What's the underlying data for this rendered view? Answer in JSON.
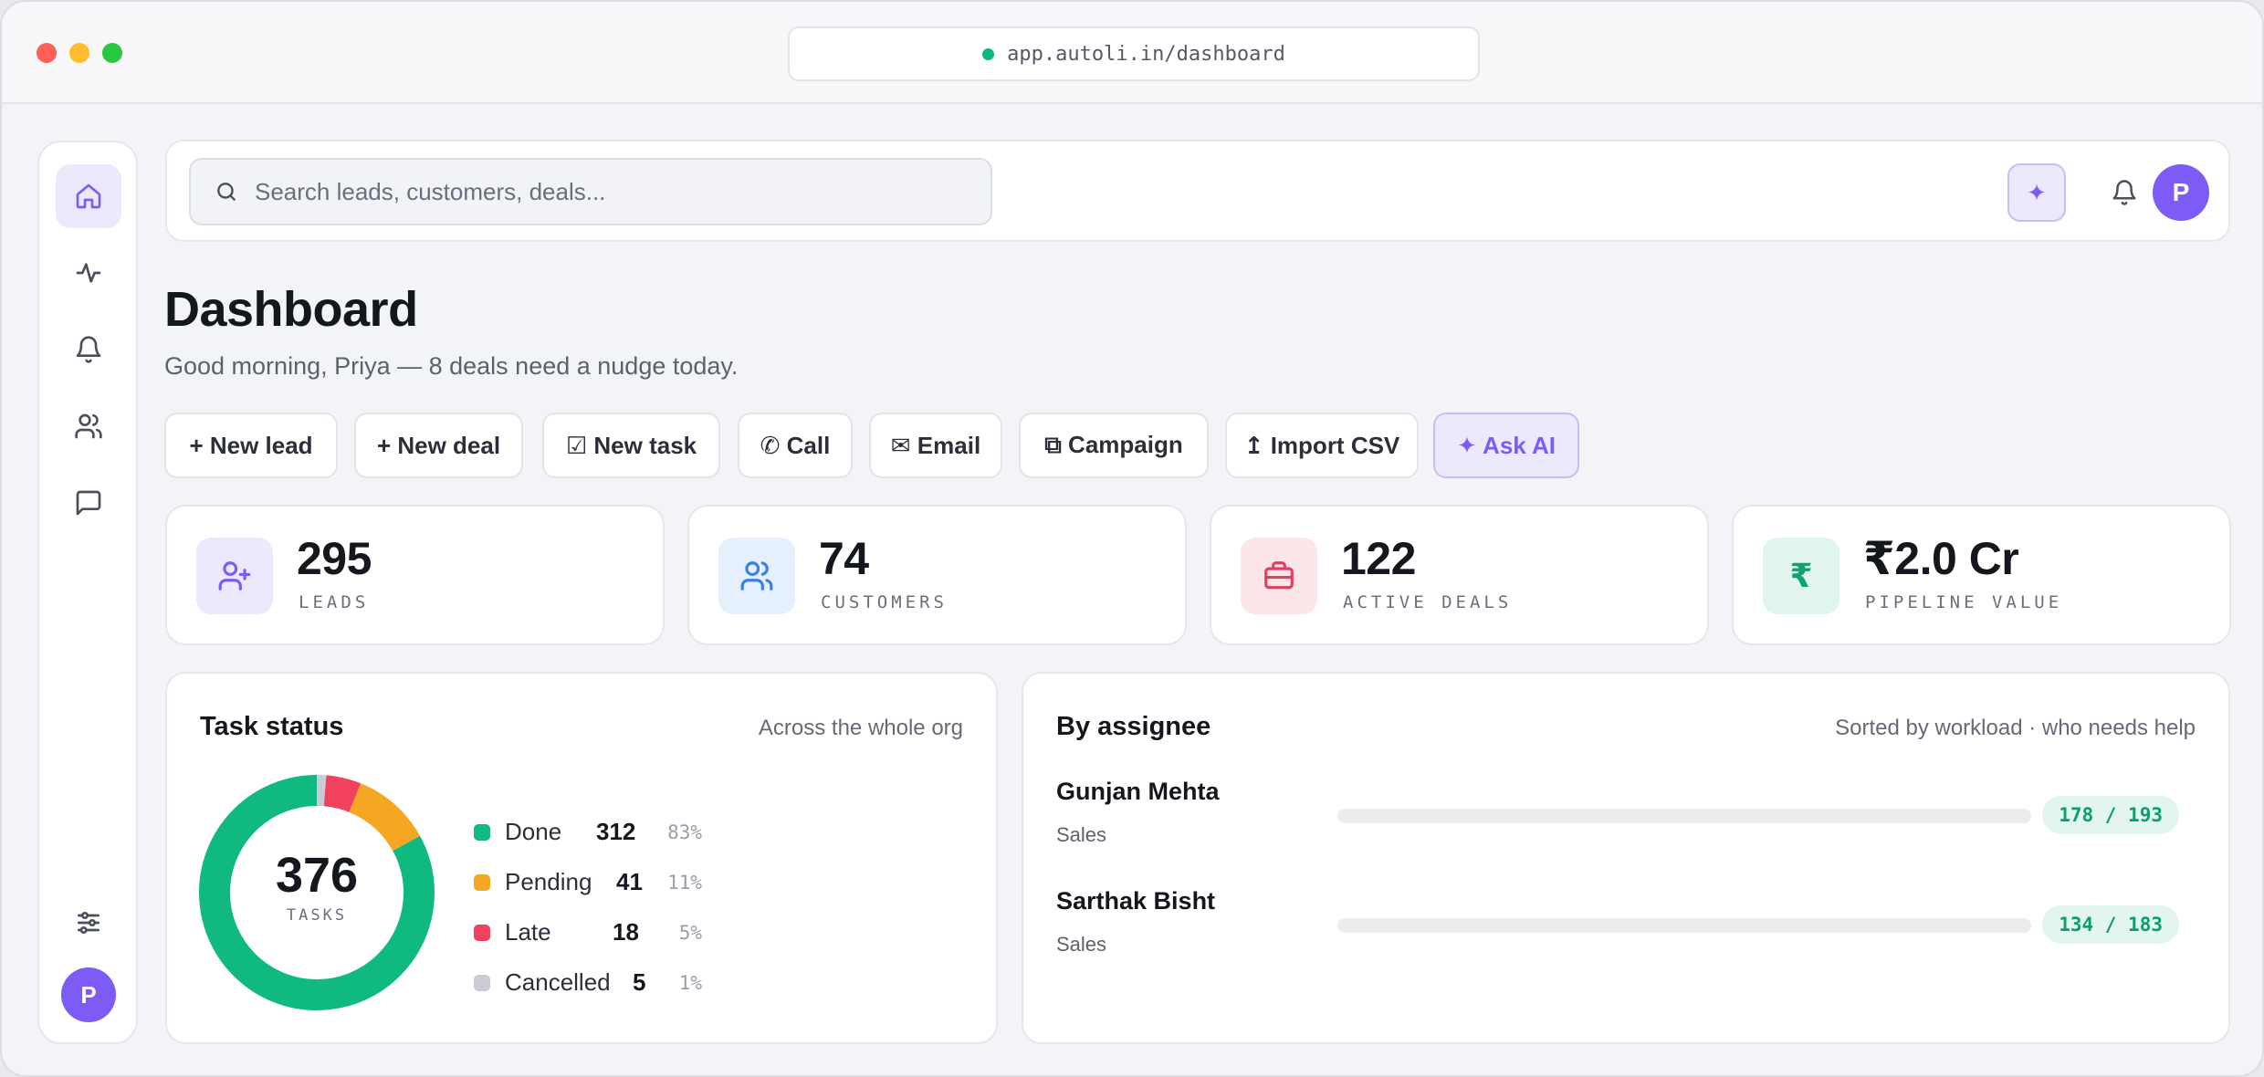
{
  "browser": {
    "url": "app.autoli.in/dashboard"
  },
  "search": {
    "placeholder": "Search leads, customers, deals..."
  },
  "user": {
    "initial": "P"
  },
  "ai_button": {
    "glyph": "✦"
  },
  "page": {
    "title": "Dashboard",
    "subtitle": "Good morning, Priya — 8 deals need a nudge today."
  },
  "actions": [
    {
      "label": "+ New lead"
    },
    {
      "label": "+ New deal"
    },
    {
      "label": "☑ New task"
    },
    {
      "label": "✆ Call"
    },
    {
      "label": "✉ Email"
    },
    {
      "label": "⧉ Campaign"
    },
    {
      "label": "↥ Import CSV"
    },
    {
      "label": "✦ Ask AI"
    }
  ],
  "stats": [
    {
      "value": "295",
      "label": "LEADS",
      "icon": "user-plus-icon",
      "color": "#7c5cf4",
      "bg": "#ede9fd"
    },
    {
      "value": "74",
      "label": "CUSTOMERS",
      "icon": "users-icon",
      "color": "#3b7fe8",
      "bg": "#e6effc"
    },
    {
      "value": "122",
      "label": "ACTIVE DEALS",
      "icon": "briefcase-icon",
      "color": "#e0405e",
      "bg": "#fde6ea"
    },
    {
      "value": "₹2.0 Cr",
      "label": "PIPELINE VALUE",
      "icon": "rupee-icon",
      "color": "#10a36f",
      "bg": "#e0f5ec"
    }
  ],
  "task_status": {
    "title": "Task status",
    "note": "Across the whole org",
    "total": "376",
    "total_label": "TASKS",
    "items": [
      {
        "name": "Done",
        "count": "312",
        "pct": "83%",
        "value": 312,
        "color": "#10b981"
      },
      {
        "name": "Pending",
        "count": "41",
        "pct": "11%",
        "value": 41,
        "color": "#f5a623"
      },
      {
        "name": "Late",
        "count": "18",
        "pct": "5%",
        "value": 18,
        "color": "#f0415e"
      },
      {
        "name": "Cancelled",
        "count": "5",
        "pct": "1%",
        "value": 5,
        "color": "#c9ccd6"
      }
    ]
  },
  "assignees": {
    "title": "By assignee",
    "note": "Sorted by workload · who needs help",
    "rows": [
      {
        "name": "Gunjan Mehta",
        "role": "Sales",
        "badge": "178 / 193",
        "progress": 0
      },
      {
        "name": "Sarthak Bisht",
        "role": "Sales",
        "badge": "134 / 183",
        "progress": 0
      }
    ]
  }
}
